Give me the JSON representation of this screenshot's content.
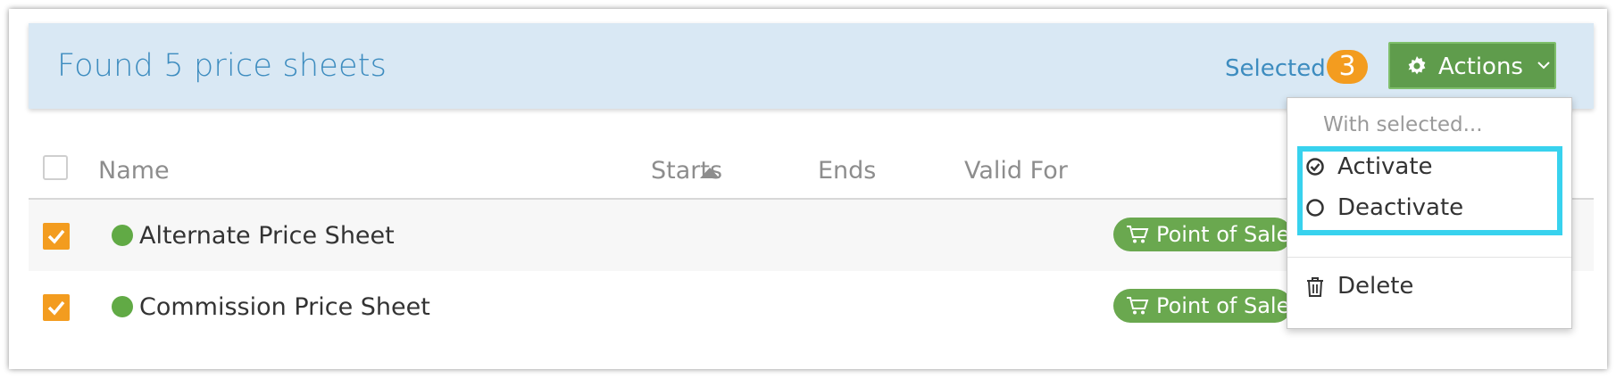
{
  "header": {
    "title": "Found 5 price sheets",
    "selected_label": "Selected",
    "selected_count": "3",
    "actions_label": "Actions"
  },
  "table": {
    "columns": [
      "Name",
      "Starts",
      "Ends",
      "Valid For"
    ],
    "sort": {
      "column": "Name",
      "direction": "ascending"
    },
    "rows": [
      {
        "name": "Alternate Price Sheet",
        "checked": true,
        "status_color": "#61aa45",
        "valid_for": "Point of Sale"
      },
      {
        "name": "Commission Price Sheet",
        "checked": true,
        "status_color": "#61aa45",
        "valid_for": "Point of Sale"
      }
    ]
  },
  "dropdown": {
    "header": "With selected...",
    "items": [
      {
        "label": "Activate",
        "icon": "check-circle-icon"
      },
      {
        "label": "Deactivate",
        "icon": "circle-outline-icon"
      },
      {
        "label": "Delete",
        "icon": "trash-icon"
      }
    ]
  },
  "colors": {
    "accent_blue": "#3d8cbf",
    "header_bg": "#d9e8f4",
    "badge_orange": "#f39c1f",
    "actions_green": "#5f9c4c",
    "pos_green": "#6aa84f",
    "highlight_cyan": "#38d2ee"
  }
}
